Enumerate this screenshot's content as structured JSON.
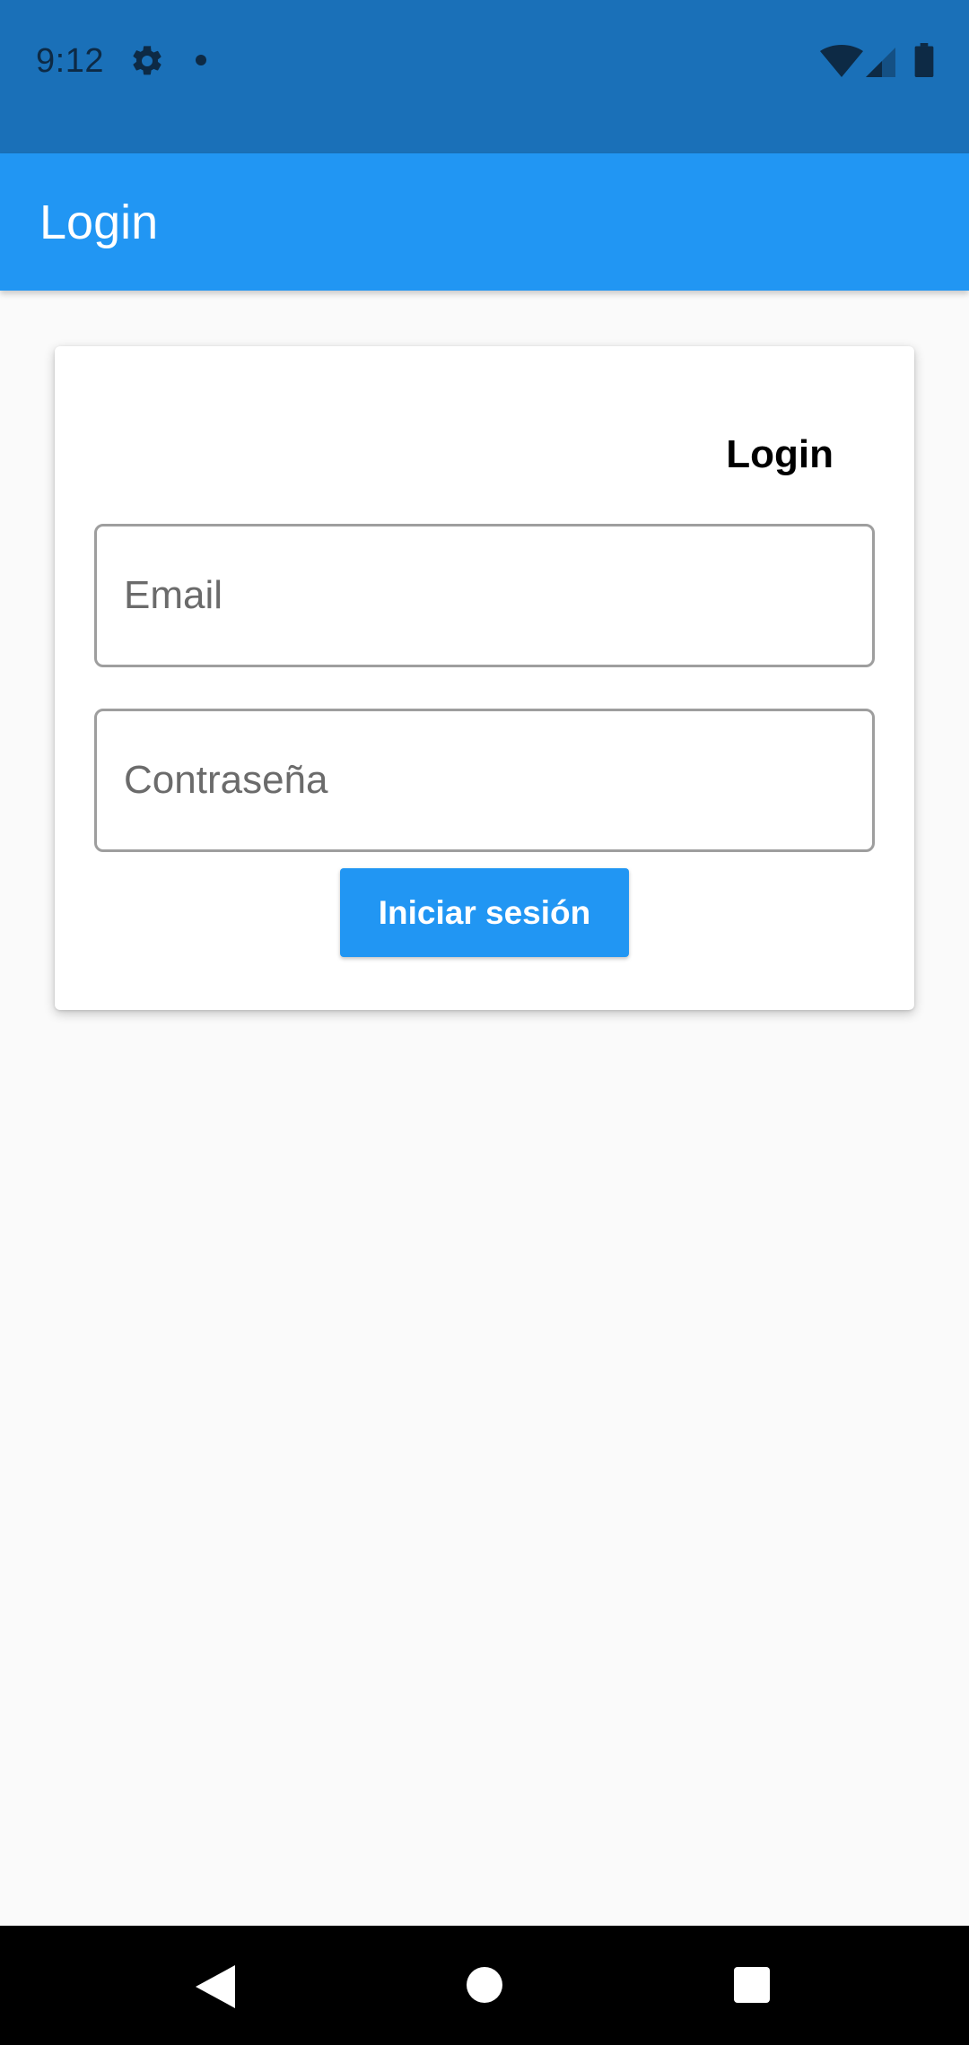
{
  "status_bar": {
    "time": "9:12",
    "icons": [
      "gear-icon",
      "notification-dot-icon",
      "wifi-icon",
      "cell-signal-icon",
      "battery-icon"
    ],
    "background_color": "#1a70b8"
  },
  "app_bar": {
    "title": "Login",
    "background_color": "#2196f3"
  },
  "login_card": {
    "title": "Login",
    "email": {
      "placeholder": "Email",
      "value": ""
    },
    "password": {
      "placeholder": "Contraseña",
      "value": ""
    },
    "submit_label": "Iniciar sesión",
    "button_color": "#2196f3"
  },
  "nav_bar": {
    "icons": [
      "back-icon",
      "home-icon",
      "recents-icon"
    ]
  }
}
